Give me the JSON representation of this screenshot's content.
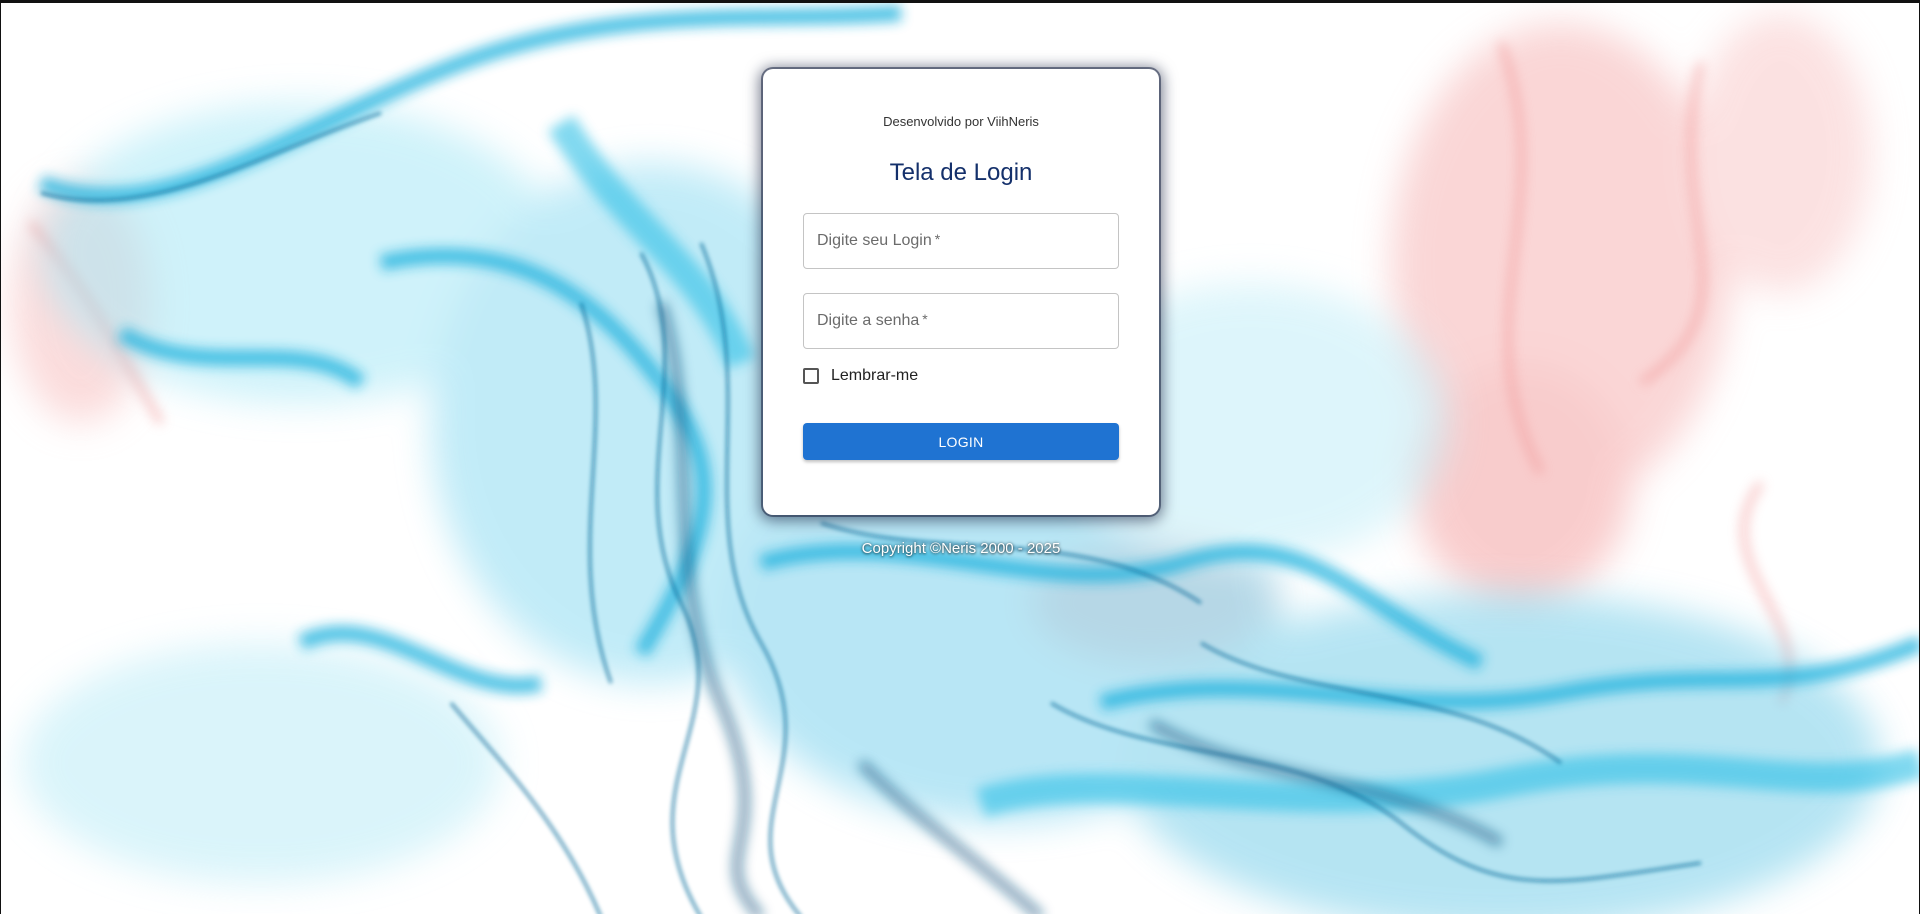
{
  "colors": {
    "background": "#ffffff",
    "card": "#ffffff",
    "title": "#14306b",
    "button": "#1f73d2",
    "smoke_blue": "#10a8d8",
    "smoke_dark": "#0a4f7c",
    "smoke_red": "#f07a7a"
  },
  "login_card": {
    "developer_credit": "Desenvolvido por ViihNeris",
    "title": "Tela de Login",
    "login_field": {
      "placeholder": "Digite seu Login",
      "required_mark": "*",
      "value": ""
    },
    "password_field": {
      "placeholder": "Digite a senha",
      "required_mark": "*",
      "value": ""
    },
    "remember_me": {
      "label": "Lembrar-me",
      "checked": false
    },
    "login_button": "LOGIN"
  },
  "footer": {
    "copyright": "Copyright ©Neris 2000 - 2025"
  }
}
